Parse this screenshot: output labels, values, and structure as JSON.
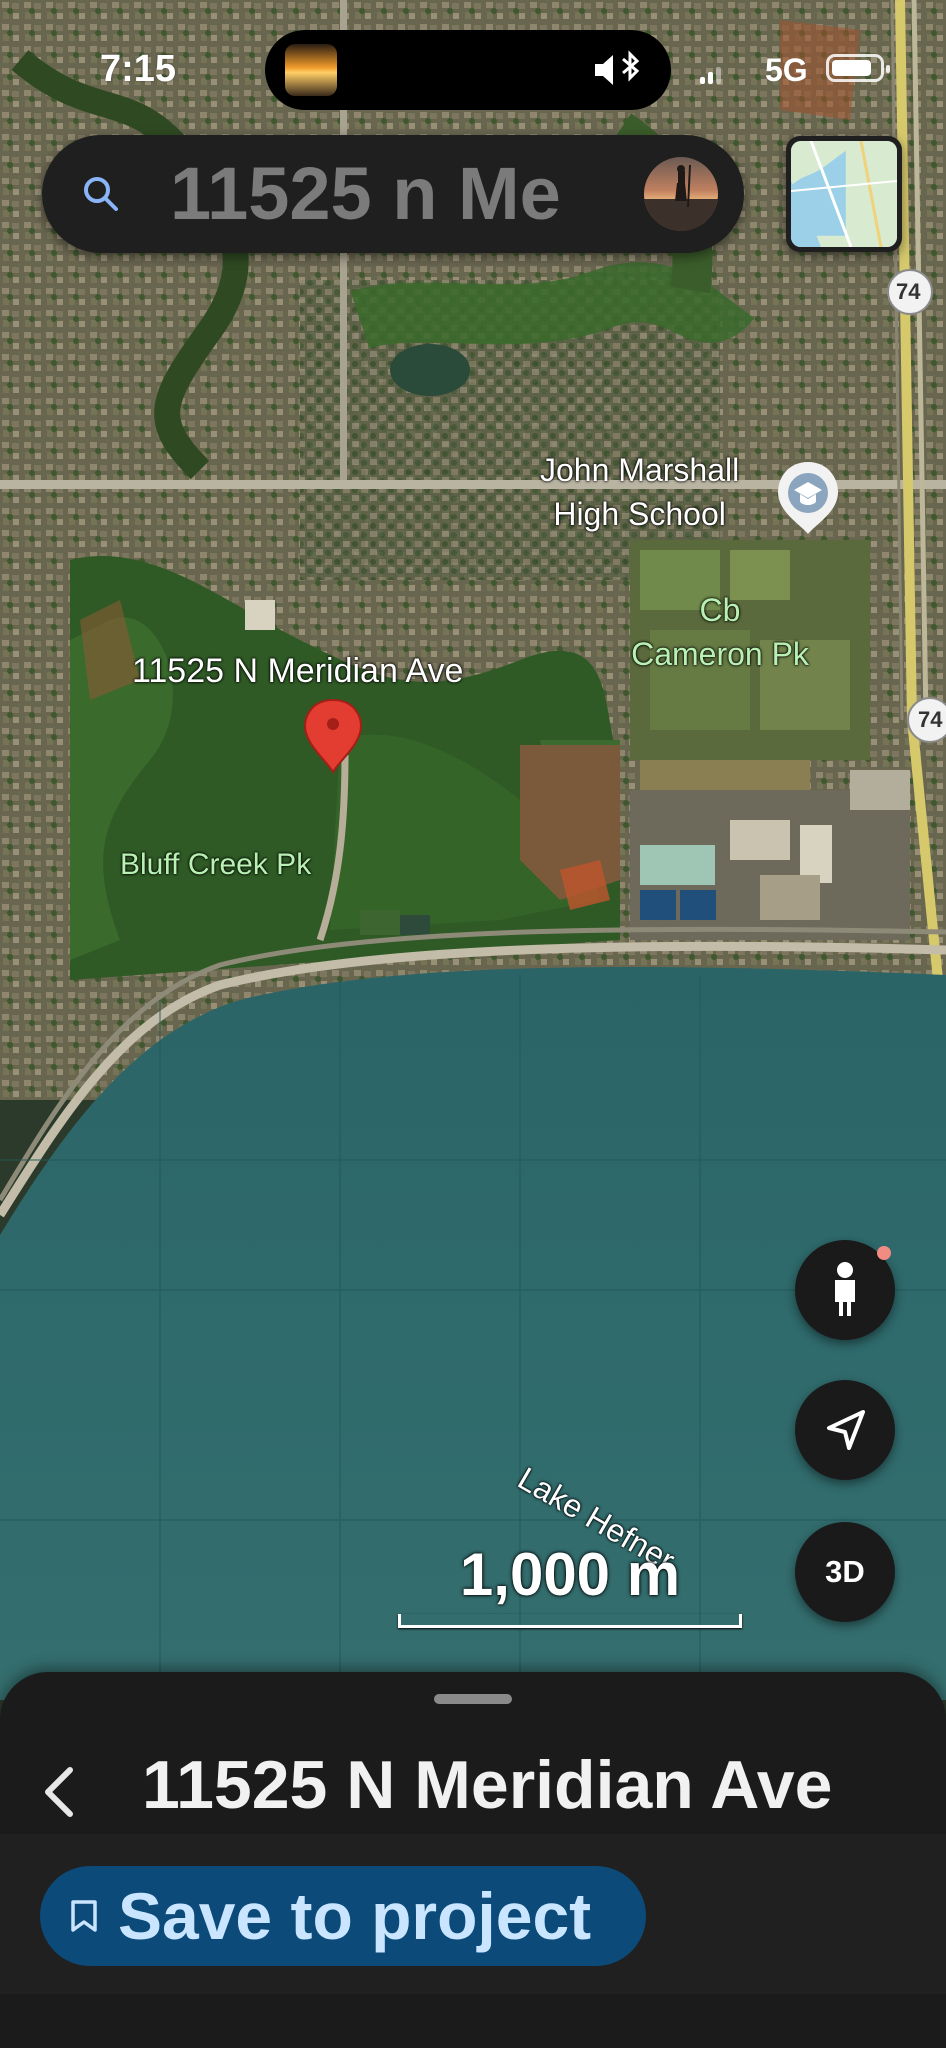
{
  "status_bar": {
    "time": "7:15",
    "network": "5G",
    "battery_level": 0.85,
    "audio_icon": "speaker-bluetooth-icon"
  },
  "search": {
    "text": "11525 n Me",
    "icon": "search-icon"
  },
  "map": {
    "labels": {
      "john_marshall": "John Marshall\nHigh School",
      "cb_cameron": "Cb\nCameron Pk",
      "pin_address": "11525 N Meridian Ave",
      "bluff_creek": "Bluff Creek Pk",
      "lake_hefner": "Lake Hefner"
    },
    "route_shield": "74"
  },
  "controls": {
    "fab_3d_label": "3D",
    "scale_label": "1,000 m"
  },
  "sheet": {
    "title": "11525 N Meridian Ave",
    "save_label": "Save to project"
  },
  "colors": {
    "lake": "#2f6a6c",
    "save_button": "#0b4a79",
    "save_text": "#c9e5ff",
    "pin": "#e33c30"
  }
}
